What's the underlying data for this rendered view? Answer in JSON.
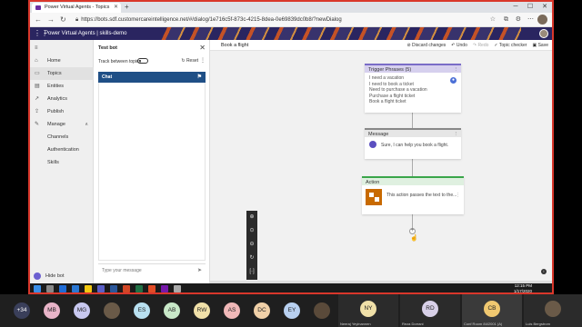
{
  "browser": {
    "tab_title": "Power Virtual Agents - Topics",
    "url": "https://bots.sdf.customercareintelligence.net/#/dialog/1e716c5f-873c-4215-8dea-0e69839dc0b8/?newDialog"
  },
  "app": {
    "title": "Power Virtual Agents | skills-demo"
  },
  "nav": {
    "items": [
      {
        "label": "Home",
        "icon": "home-icon"
      },
      {
        "label": "Topics",
        "icon": "chat-icon"
      },
      {
        "label": "Entities",
        "icon": "entities-icon"
      },
      {
        "label": "Analytics",
        "icon": "analytics-icon"
      },
      {
        "label": "Publish",
        "icon": "publish-icon"
      },
      {
        "label": "Manage",
        "icon": "wrench-icon"
      },
      {
        "label": "Channels"
      },
      {
        "label": "Authentication"
      },
      {
        "label": "Skills"
      }
    ],
    "hide_bot": "Hide bot"
  },
  "testbot": {
    "title": "Test bot",
    "track_label": "Track between topics",
    "reset": "Reset",
    "chat_label": "Chat",
    "placeholder": "Type your message"
  },
  "canvas": {
    "breadcrumb": "Book a flight",
    "commands": {
      "discard": "Discard changes",
      "undo": "Undo",
      "redo": "Redo",
      "checker": "Topic checker",
      "save": "Save"
    },
    "trigger": {
      "title": "Trigger Phrases (5)",
      "phrases": [
        "I need a vacation",
        "I need to book a ticket",
        "Need to purchase a vacation",
        "Purchase a flight ticket",
        "Book a flight ticket"
      ]
    },
    "message": {
      "title": "Message",
      "text": "Sure, I can help you book a flight."
    },
    "action": {
      "title": "Action",
      "text": "This action passes the text to the..."
    },
    "zoom_tools": [
      "⊕",
      "⊙",
      "⊖",
      "↻",
      "[·]"
    ]
  },
  "taskbar": {
    "time": "12:15 PM",
    "date": "1/17/2020"
  },
  "participants": {
    "count": "+34",
    "avatars": [
      {
        "initials": "MB",
        "color": "#e8b4c8"
      },
      {
        "initials": "MG",
        "color": "#c8c8f0"
      },
      {
        "initials": "",
        "color": "#6a5a48"
      },
      {
        "initials": "ES",
        "color": "#b8e0f0"
      },
      {
        "initials": "AB",
        "color": "#c8e8c8"
      },
      {
        "initials": "RW",
        "color": "#f0e0a8"
      },
      {
        "initials": "AS",
        "color": "#f0b8b8"
      },
      {
        "initials": "DC",
        "color": "#f0d0a8"
      },
      {
        "initials": "EY",
        "color": "#b8d0f0"
      },
      {
        "initials": "",
        "color": "#5a4a3a"
      }
    ],
    "tiles": [
      {
        "initials": "NY",
        "color": "#f0e0a8",
        "name": "Neeraj Yeyinannen"
      },
      {
        "initials": "RD",
        "color": "#d8d0e8",
        "name": "Reza Dorrani"
      },
      {
        "initials": "CB",
        "color": "#f0c870",
        "name": "Conf Room 84/2001 (A)"
      },
      {
        "initials": "",
        "color": "#6a5a48",
        "name": "Luis Bergstrom"
      }
    ]
  }
}
